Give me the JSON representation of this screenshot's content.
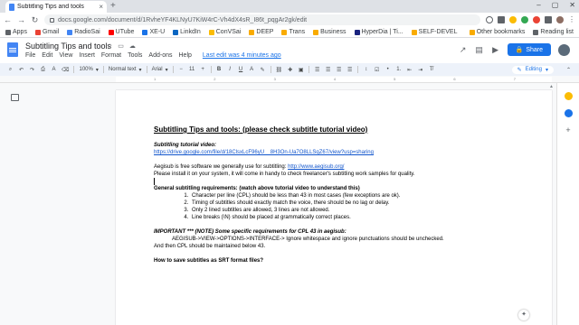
{
  "browser": {
    "tab_title": "Subtitling Tips and tools",
    "new_tab": "+",
    "url": "docs.google.com/document/d/1RvheYF4KLNyU7KiW4rC-Vh4dX4sR_I86t_pqgAr2gk/edit",
    "bookmarks": [
      {
        "label": "Apps",
        "color": "#5f6368"
      },
      {
        "label": "Gmail",
        "color": "#ea4335"
      },
      {
        "label": "RadioSai",
        "color": "#4285f4"
      },
      {
        "label": "UTube",
        "color": "#ff0000"
      },
      {
        "label": "XE-U",
        "color": "#1a73e8"
      },
      {
        "label": "LinkdIn",
        "color": "#0a66c2"
      },
      {
        "label": "ConVSai",
        "color": "#fbbc04"
      },
      {
        "label": "DEEP",
        "color": "#f9ab00"
      },
      {
        "label": "Trans",
        "color": "#f9ab00"
      },
      {
        "label": "Business",
        "color": "#f9ab00"
      },
      {
        "label": "HyperDia | Ti...",
        "color": "#1a237e"
      },
      {
        "label": "SELF-DEVEL",
        "color": "#f9ab00"
      }
    ],
    "other_bookmarks": "Other bookmarks",
    "reading_list": "Reading list"
  },
  "docs": {
    "title": "Subtitling Tips and tools",
    "menu": [
      "File",
      "Edit",
      "View",
      "Insert",
      "Format",
      "Tools",
      "Add-ons",
      "Help"
    ],
    "last_edit": "Last edit was 4 minutes ago",
    "share_label": "Share"
  },
  "toolbar": {
    "zoom": "100%",
    "style": "Normal text",
    "font": "Arial",
    "font_size": "11",
    "mode": "Editing"
  },
  "document": {
    "heading": "Subtitling Tips and tools: (please check subtitle tutorial video)",
    "tutorial_label": "Subtitling tutorial video:",
    "tutorial_link": "https://drive.google.com/file/d/18ClsxLcF96yU__8H3On-Ua7O8LLSqZ67/view?usp=sharing",
    "aegisub_line1": "Aegisub is free software we generally use for subtitling: ",
    "aegisub_link": "http://www.aegisub.org/",
    "aegisub_line2": "Please install it on your system, it will come in handy to check freelancer's subtitling work samples for quality.",
    "req_heading": "General subtitling requirements: (watch above tutorial video to understand this)",
    "requirements": [
      "Character per line (CPL) should be less than 43 in most cases (few exceptions are ok).",
      "Timing of subtitles should exactly match the voice, there should be no lag or delay.",
      "Only 2 lined subtitles are allowed, 3 lines are not allowed.",
      "Line breaks (\\N) should be placed at grammatically correct places."
    ],
    "important_heading": "IMPORTANT *** (NOTE) Some specific requirements for CPL 43 in aegisub:",
    "important_line1": "AEGISUB->VIEW->OPTIONS->INTERFACE-> Ignore whitespace and ignore punctuations should be unchecked.",
    "important_line2": "And then CPL should be maintained below 43.",
    "save_heading": "How to save subtitles as SRT format files?"
  }
}
